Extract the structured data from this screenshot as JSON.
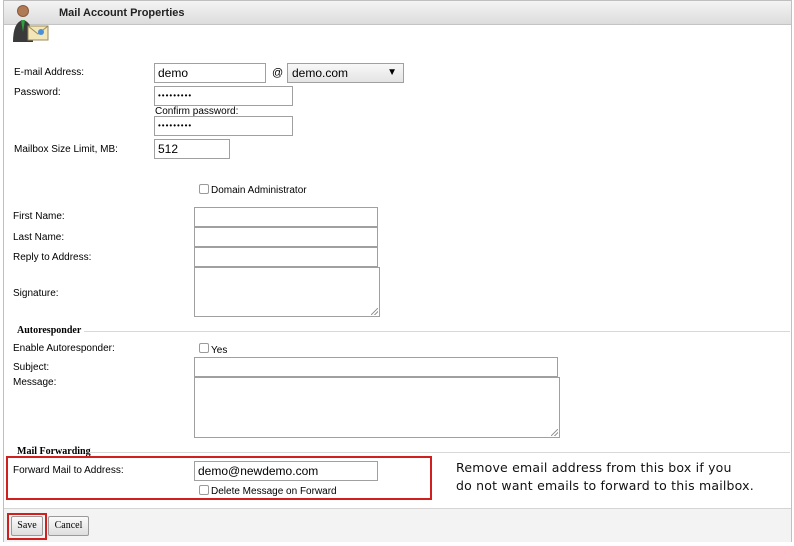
{
  "header": {
    "title": "Mail Account Properties"
  },
  "account": {
    "email_label": "E-mail Address:",
    "email_value": "demo",
    "at_sign": "@",
    "domain_value": "demo.com",
    "password_label": "Password:",
    "password_value": "•••••••••",
    "confirm_label": "Confirm password:",
    "confirm_value": "•••••••••",
    "mailbox_label": "Mailbox Size Limit, MB:",
    "mailbox_value": "512",
    "domain_admin_label": "Domain Administrator"
  },
  "profile": {
    "first_name_label": "First Name:",
    "last_name_label": "Last Name:",
    "reply_label": "Reply to Address:",
    "signature_label": "Signature:"
  },
  "autoresponder": {
    "section_title": "Autoresponder",
    "enable_label": "Enable Autoresponder:",
    "yes_label": "Yes",
    "subject_label": "Subject:",
    "message_label": "Message:"
  },
  "forwarding": {
    "section_title": "Mail Forwarding",
    "forward_label": "Forward Mail to Address:",
    "forward_value": "demo@newdemo.com",
    "delete_label": "Delete Message on Forward"
  },
  "note": {
    "line1": "Remove email address from this box if you",
    "line2": "do not want emails to forward to this mailbox."
  },
  "buttons": {
    "save": "Save",
    "cancel": "Cancel"
  }
}
